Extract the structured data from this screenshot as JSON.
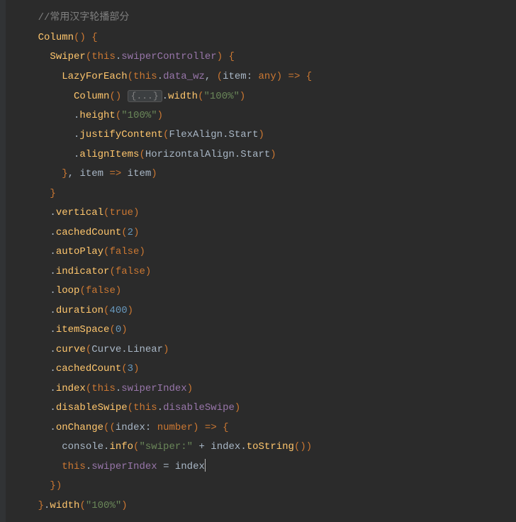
{
  "code": {
    "comment": "//常用汉字轮播部分",
    "column": "Column",
    "swiper": "Swiper",
    "thisKw": "this",
    "swiperController": "swiperController",
    "lazyForEach": "LazyForEach",
    "data_wz": "data_wz",
    "item": "item",
    "anyType": "any",
    "folded": "{...}",
    "width": "width",
    "pct100": "\"100%\"",
    "height": "height",
    "justifyContent": "justifyContent",
    "flexAlign": "FlexAlign",
    "start": "Start",
    "alignItems": "alignItems",
    "horizontalAlign": "HorizontalAlign",
    "vertical": "vertical",
    "trueKw": "true",
    "cachedCount": "cachedCount",
    "two": "2",
    "autoPlay": "autoPlay",
    "falseKw": "false",
    "indicator": "indicator",
    "loop": "loop",
    "duration": "duration",
    "d400": "400",
    "itemSpace": "itemSpace",
    "zero": "0",
    "curve": "curve",
    "curveType": "Curve",
    "linear": "Linear",
    "three": "3",
    "indexFn": "index",
    "swiperIndex": "swiperIndex",
    "disableSwipe": "disableSwipe",
    "onChange": "onChange",
    "numberType": "number",
    "console": "console",
    "info": "info",
    "swiperStr": "\"swiper:\"",
    "toString": "toString"
  }
}
